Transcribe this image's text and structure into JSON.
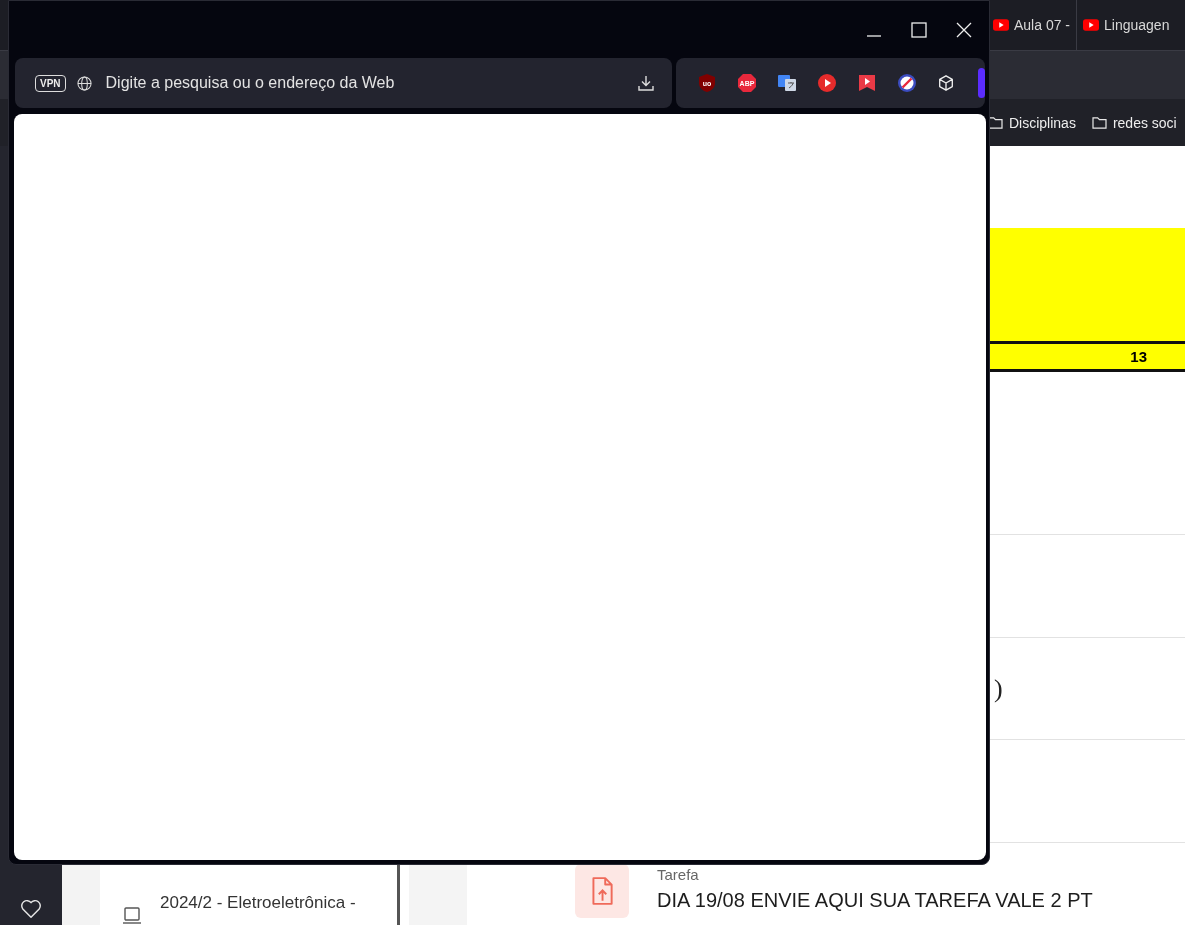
{
  "background_browser": {
    "tabs": [
      {
        "title": "Aula 07 - "
      },
      {
        "title": "Linguagen"
      }
    ],
    "bookmarks": [
      {
        "label": "Disciplinas"
      },
      {
        "label": "redes soci"
      }
    ]
  },
  "background_page": {
    "table_value": "13",
    "fragment": ")",
    "course_list": [
      {
        "title": "2024/2 - Eletroeletrônica -"
      }
    ],
    "activity": {
      "type": "Tarefa",
      "title": "DIA 19/08 ENVIE AQUI SUA TAREFA VALE 2 PT"
    }
  },
  "window": {
    "address_bar": {
      "vpn_badge": "VPN",
      "placeholder": "Digite a pesquisa ou o endereço da Web"
    },
    "extensions": [
      {
        "kind": "shield",
        "label": "uo"
      },
      {
        "kind": "stop",
        "label": "ABP"
      },
      {
        "kind": "translate"
      },
      {
        "kind": "play-circle"
      },
      {
        "kind": "play-bookmark"
      },
      {
        "kind": "blocked"
      },
      {
        "kind": "cube"
      }
    ]
  }
}
